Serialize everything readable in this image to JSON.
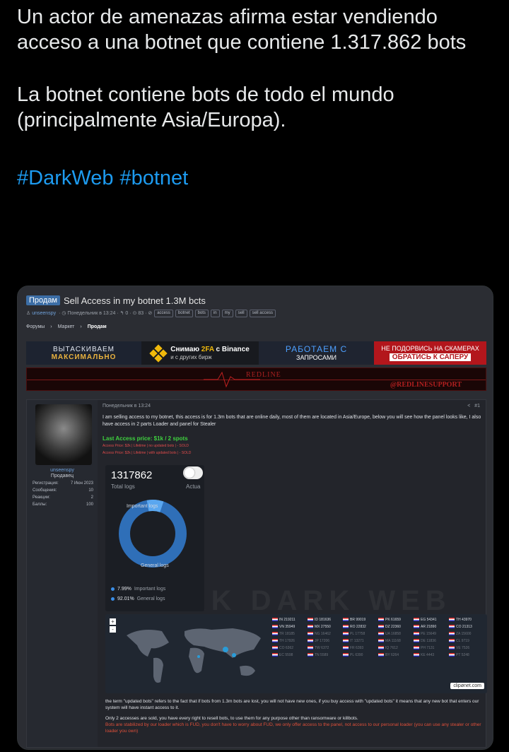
{
  "tweet": {
    "para1": "Un actor de amenazas afirma estar vendiendo acceso a una botnet que contiene 1.317.862 bots",
    "para2": "La botnet contiene bots de todo el mundo (principalmente Asia/Europa).",
    "hashtags": [
      "#DarkWeb",
      "#botnet"
    ]
  },
  "forum": {
    "prefix": "Продам",
    "title": "Sell Access in my botnet 1.3M bcts",
    "author": "unseenspy",
    "meta": "· ◷ Понедельник в 13:24 · ↰ 0 · ⊙ 83 · ⊘",
    "tags": [
      "access",
      "botnet",
      "bots",
      "in",
      "my",
      "sell",
      "sell access"
    ],
    "breadcrumbs": [
      "Форумы",
      "Маркет",
      "Продам"
    ],
    "breadcrumb_sep": "›"
  },
  "banners": {
    "b1_line1": "ВЫТАСКИВАЕМ",
    "b1_line2": "МАКСИМАЛЬНО",
    "b2_prefix": "Снимаю ",
    "b2_highlight": "2FA",
    "b2_suffix": " с Binance",
    "b2_sub": "и с других бирж",
    "b3_line1": "РАБОТАЕМ С",
    "b3_line2": "ЗАПРОСАМИ",
    "b4_line1": "НЕ ПОДОРВИСЬ НА СКАМЕРАХ",
    "b4_line2": "ОБРАТИСЬ К САПЕРУ",
    "redline_name": "REDLINE",
    "redline_support": "@REDLINESUPPORT"
  },
  "post": {
    "date": "Понедельник в 13:24",
    "share_icon": "share-icon",
    "number": "#1",
    "user": {
      "name": "unseenspy",
      "role": "Продавец",
      "stats": [
        {
          "label": "Регистрация:",
          "value": "7 Июн 2023"
        },
        {
          "label": "Сообщения:",
          "value": "10"
        },
        {
          "label": "Реакции:",
          "value": "2"
        },
        {
          "label": "Баллы:",
          "value": "100"
        }
      ]
    },
    "text": "I am selling access to my botnet, this access is for 1.3m bots that are online daily, most of them are located in Asia/Europe, below you will see how the panel looks like, I also have access in 2 parts Loader and panel for Stealer",
    "price": "Last Access price: $1k / 2 spots",
    "sold1": "Access Price: $2k | Lifetime | no updated bots | - SOLD",
    "sold2": "Access Price: $2k | Lifetime | with updated bots | - SOLD",
    "logs": {
      "total": "1317862",
      "total_label": "Total logs",
      "actual_label": "Actua",
      "important_label": "Important logs",
      "general_label": "General logs",
      "important_pct": "7.99%",
      "important_name": "Important logs",
      "general_pct": "92.01%",
      "general_name": "General logs",
      "important_fraction": 0.0799
    },
    "map": {
      "zoom_in": "+",
      "zoom_out": "-",
      "attribution": "clipønet.com",
      "rows": [
        [
          "IN 219211",
          "ID 181636",
          "BR 99019",
          "PK 61659",
          "EG 54341",
          "TH 43970"
        ],
        [
          "VN 35949",
          "MX 27550",
          "RO 22832",
          "DZ 22360",
          "AR 21890",
          "CO 21313"
        ],
        [
          "TR 18185",
          "NG 16462",
          "PL 17758",
          "UA 16858",
          "PE 15649",
          "ZA 15600"
        ],
        [
          "TH 17926",
          "JP 17206",
          "IT 13271",
          "MA 11168",
          "DE 11836",
          "CL 9719"
        ],
        [
          "CO 6362",
          "TW 6372",
          "FR 6393",
          "IQ 7612",
          "PH 7131",
          "VE 7526"
        ],
        [
          "EC 5598",
          "TN 5589",
          "PL 6390",
          "BY 6264",
          "KE 4443",
          "PT 5248"
        ]
      ]
    },
    "foot1": "the term \"updated bots\" refers to the fact that if bots from 1.3m bots are lost, you will not have new ones, if you buy access with \"updated bots\" it means that any new bot that enters our system will have instant access to it.",
    "foot2": "Only 2 accesses are sold, you have every right to resell bots, to use them for any purpose other than ransomware or killbots.",
    "foot3": "Bots are stabilized by our loader which is FUD, you don't have to worry about FUD, we only offer access to the panel, not access to our personal loader (you can use any stealer or other loader you own)",
    "watermark": "DARK  DARK WEB"
  },
  "colors": {
    "hashtag": "#1d9bf0",
    "donut": "#3a8ee6",
    "price_green": "#3fd13f",
    "sold_red": "#e04b4b"
  }
}
